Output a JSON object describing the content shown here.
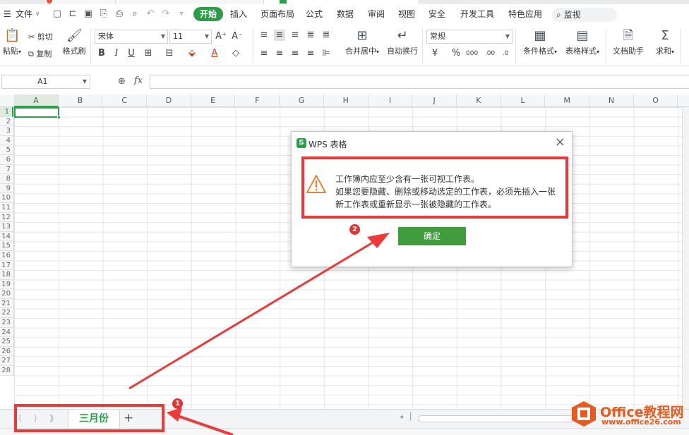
{
  "menubar": {
    "file": "文件",
    "tabs": [
      "开始",
      "插入",
      "页面布局",
      "公式",
      "数据",
      "审阅",
      "视图",
      "安全",
      "开发工具",
      "特色应用"
    ],
    "active_tab": "开始",
    "search": "监视"
  },
  "ribbon": {
    "paste": "粘贴",
    "cut": "剪切",
    "copy": "复制",
    "format_painter": "格式刷",
    "font_name": "宋体",
    "font_size": "11",
    "merge_center": "合并居中",
    "wrap_text": "自动换行",
    "number_format": "常规",
    "conditional_format": "条件格式",
    "table_style": "表格样式",
    "doc_assistant": "文档助手",
    "sum": "求和"
  },
  "formula_bar": {
    "cell_ref": "A1",
    "fx": "fx"
  },
  "grid": {
    "columns": [
      "A",
      "B",
      "C",
      "D",
      "E",
      "F",
      "G",
      "H",
      "I",
      "J",
      "K",
      "L",
      "M",
      "N",
      "O"
    ],
    "rows": [
      "1",
      "2",
      "3",
      "4",
      "5",
      "6",
      "7",
      "8",
      "9",
      "10",
      "11",
      "12",
      "13",
      "14",
      "15",
      "16",
      "17",
      "18",
      "19",
      "20",
      "21",
      "22",
      "23",
      "24",
      "25",
      "26",
      "27",
      "28"
    ],
    "selected_cell": "A1"
  },
  "sheet_tabs": {
    "sheets": [
      "三月份"
    ],
    "add": "+"
  },
  "dialog": {
    "title": "WPS 表格",
    "logo_letter": "S",
    "close": "×",
    "message_lines": [
      "工作簿内应至少含有一张可视工作表。",
      "如果您要隐藏、删除或移动选定的工作表，必须先插入一张",
      "新工作表或重新显示一张被隐藏的工作表。"
    ],
    "ok": "确定"
  },
  "annotations": {
    "badge1": "1",
    "badge2": "2",
    "color": "#ef3838"
  },
  "watermark": {
    "brand": "Office教程网",
    "url": "www.office26.com"
  },
  "colors": {
    "accent": "#2aa048",
    "ok_button": "#3f9d3b",
    "annotation_red": "#ef3838",
    "watermark_orange": "#e85b1c"
  }
}
